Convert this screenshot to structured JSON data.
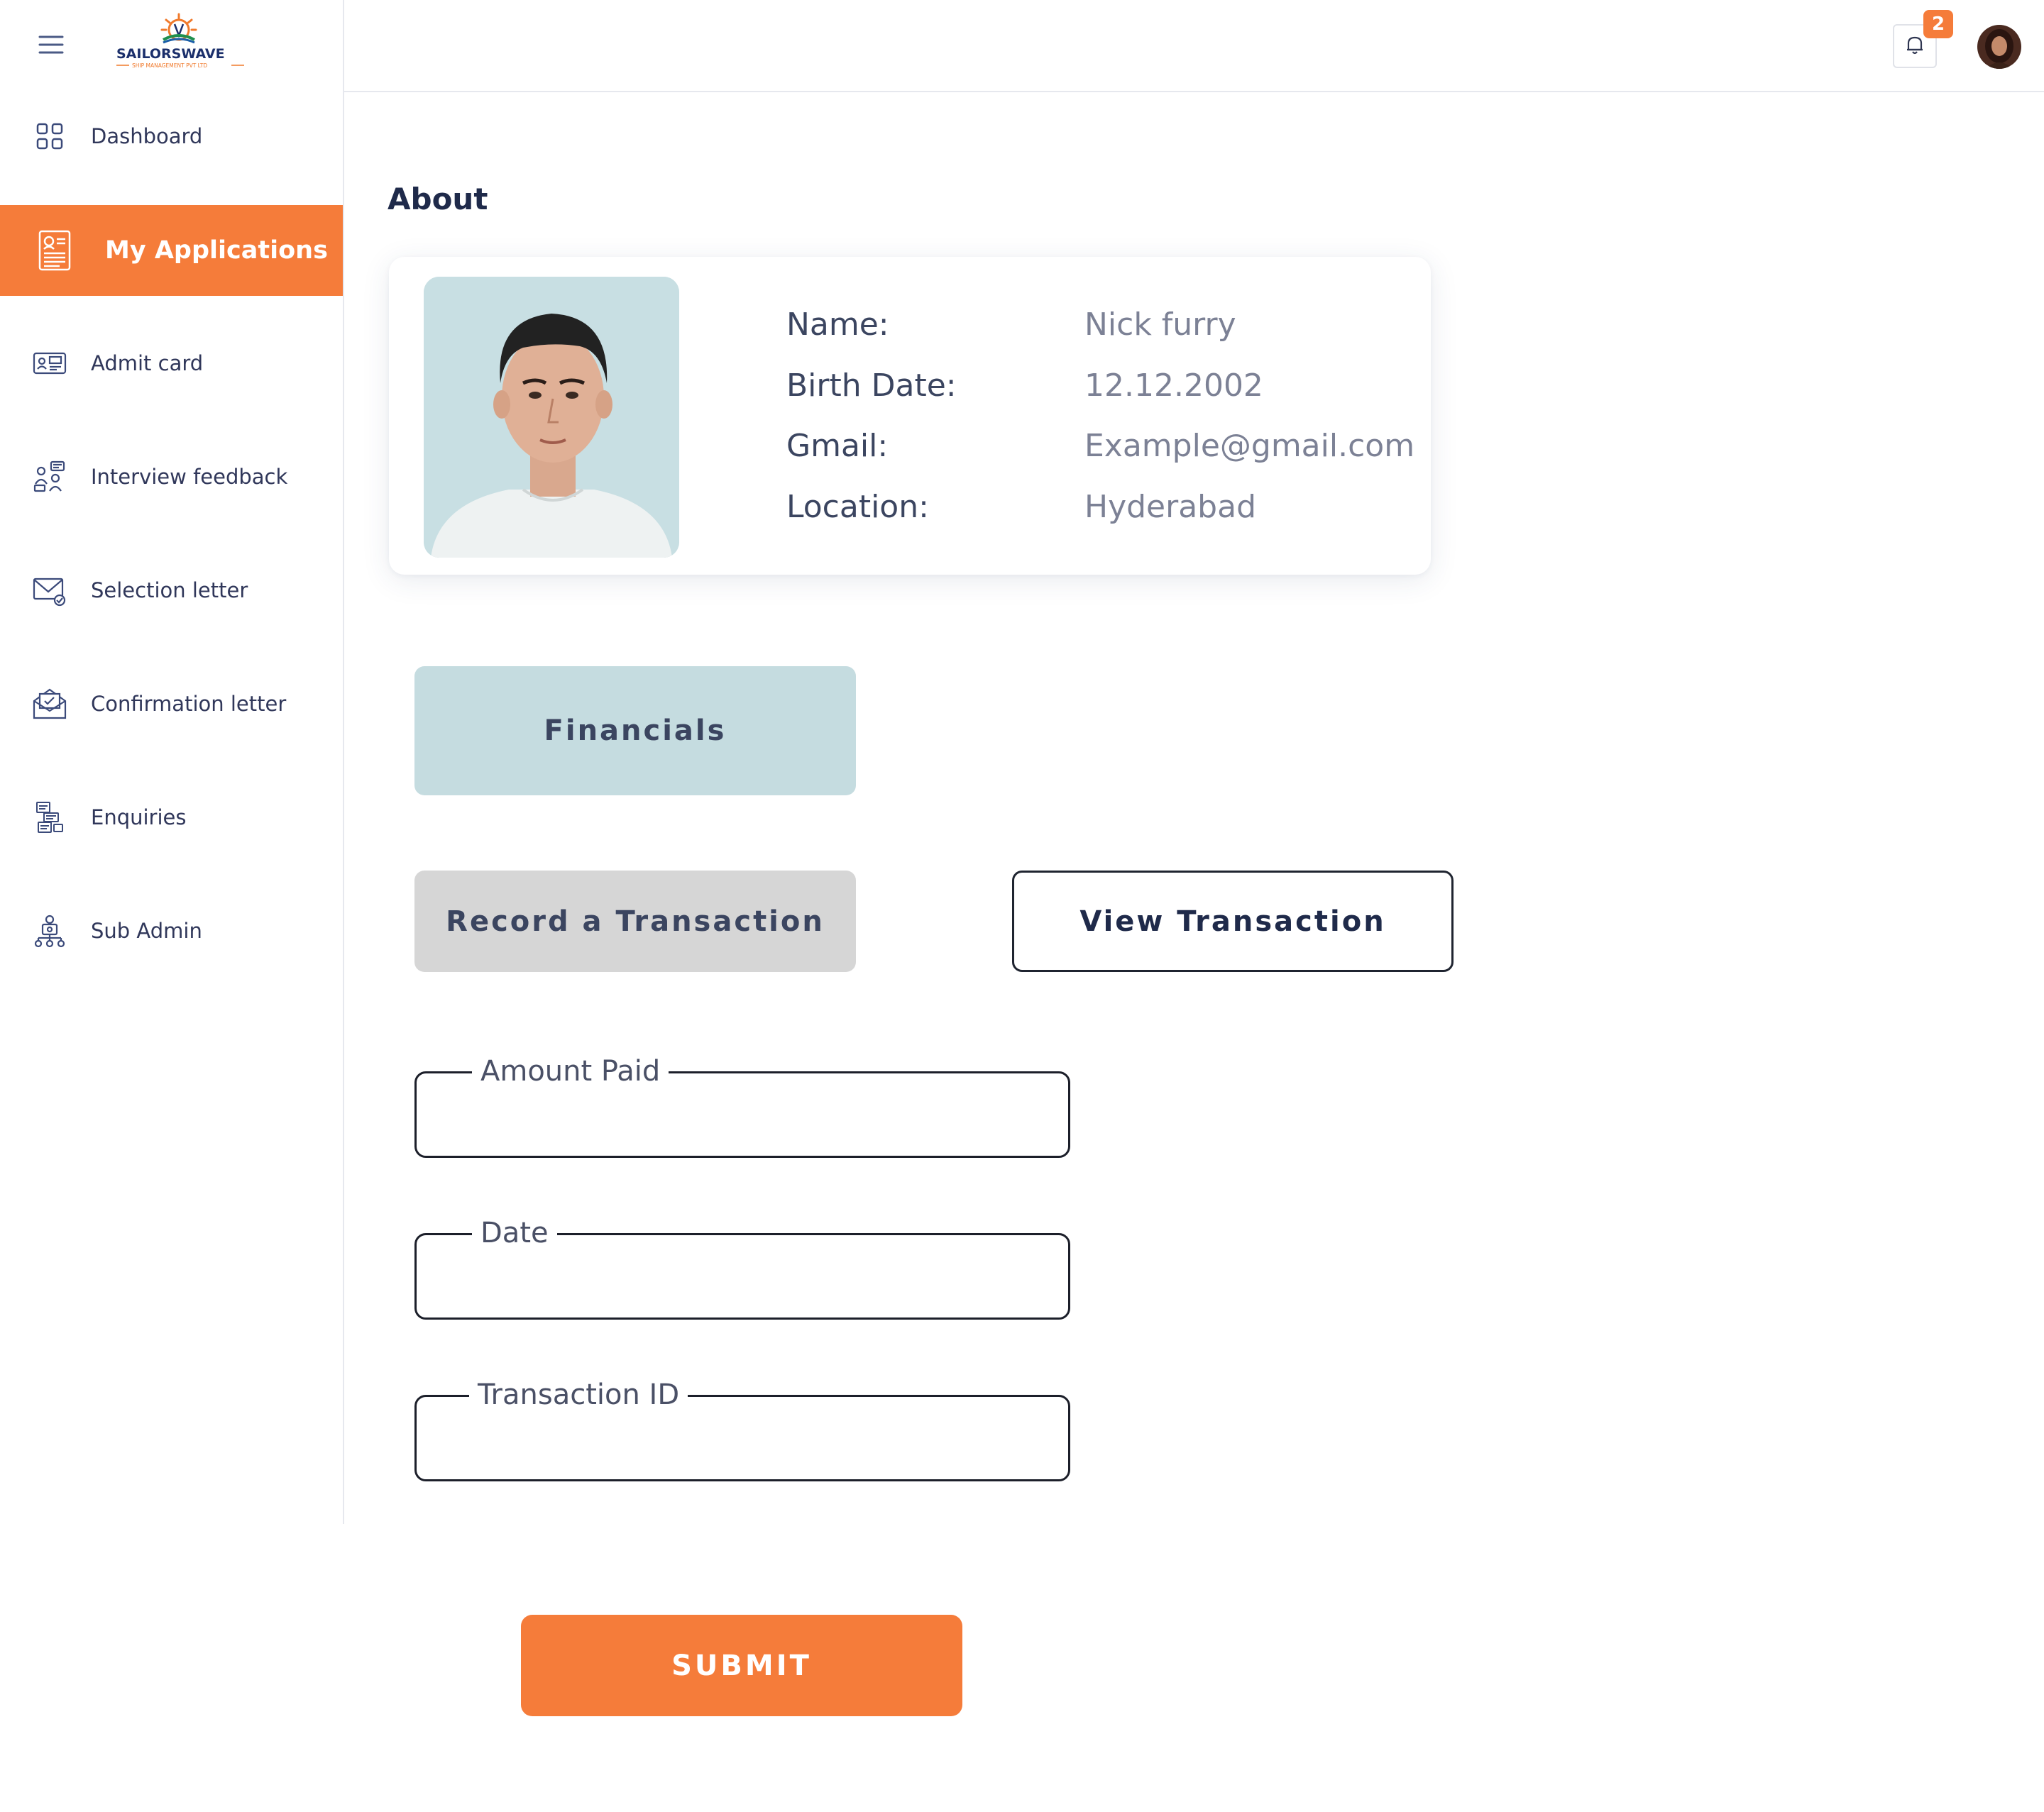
{
  "brand": {
    "name": "SAILORSWAVE",
    "tagline": "SHIP MANAGEMENT PVT LTD"
  },
  "sidebar": {
    "items": [
      {
        "label": "Dashboard",
        "icon": "dashboard-grid-icon"
      },
      {
        "label": "My Applications",
        "icon": "application-document-icon",
        "active": true
      },
      {
        "label": "Admit card",
        "icon": "id-card-icon"
      },
      {
        "label": "Interview feedback",
        "icon": "interview-people-icon"
      },
      {
        "label": "Selection letter",
        "icon": "mail-check-icon"
      },
      {
        "label": "Confirmation letter",
        "icon": "open-envelope-icon"
      },
      {
        "label": "Enquiries",
        "icon": "enquiries-docs-icon"
      },
      {
        "label": "Sub Admin",
        "icon": "org-hierarchy-icon"
      }
    ]
  },
  "header": {
    "notifications_count": "2"
  },
  "main": {
    "title": "About",
    "profile": {
      "fields": [
        {
          "label": "Name:",
          "value": "Nick furry"
        },
        {
          "label": "Birth Date:",
          "value": "12.12.2002"
        },
        {
          "label": "Gmail:",
          "value": "Example@gmail.com"
        },
        {
          "label": "Location:",
          "value": "Hyderabad"
        }
      ]
    },
    "financials_label": "Financials",
    "record_label": "Record a Transaction",
    "view_label": "View Transaction",
    "form": {
      "amount_label": "Amount Paid",
      "amount_value": "",
      "date_label": "Date",
      "date_value": "",
      "txn_label": "Transaction ID",
      "txn_value": ""
    },
    "submit_label": "SUBMIT"
  },
  "colors": {
    "accent": "#f57c3a",
    "financials_bg": "#c5dce0",
    "record_bg": "#d6d6d6",
    "text_dark": "#1f2a4a"
  }
}
